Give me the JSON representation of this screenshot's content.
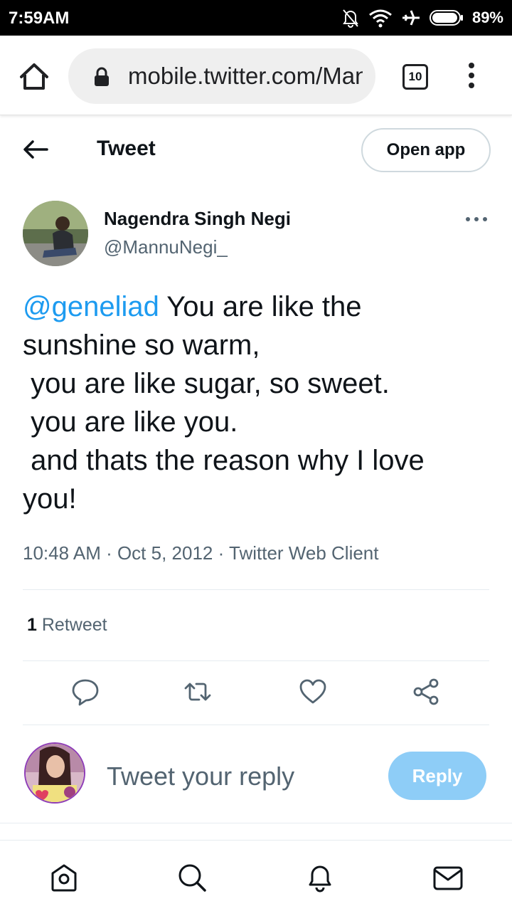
{
  "status_bar": {
    "time": "7:59AM",
    "battery": "89%",
    "icons": [
      "bell-off-icon",
      "wifi-icon",
      "airplane-icon",
      "battery-icon"
    ]
  },
  "browser": {
    "url": "mobile.twitter.com/MannuNegi_",
    "tab_count": "10"
  },
  "header": {
    "title": "Tweet",
    "open_app_label": "Open app"
  },
  "tweet": {
    "author_name": "Nagendra Singh Negi",
    "author_handle": "@MannuNegi_",
    "mention": "@geneliad",
    "lines": [
      " You are like the",
      "sunshine so warm,",
      " you are like sugar, so sweet.",
      " you are like you.",
      " and thats the reason why I love",
      "you!"
    ],
    "meta": "10:48 AM · Oct 5, 2012 · Twitter Web Client",
    "retweet_count": "1",
    "retweet_label": "Retweet"
  },
  "reply": {
    "placeholder": "Tweet your reply",
    "button_label": "Reply"
  },
  "colors": {
    "accent": "#1d9bf0",
    "reply_button_disabled": "#8ecdf7",
    "secondary_text": "#536471"
  }
}
